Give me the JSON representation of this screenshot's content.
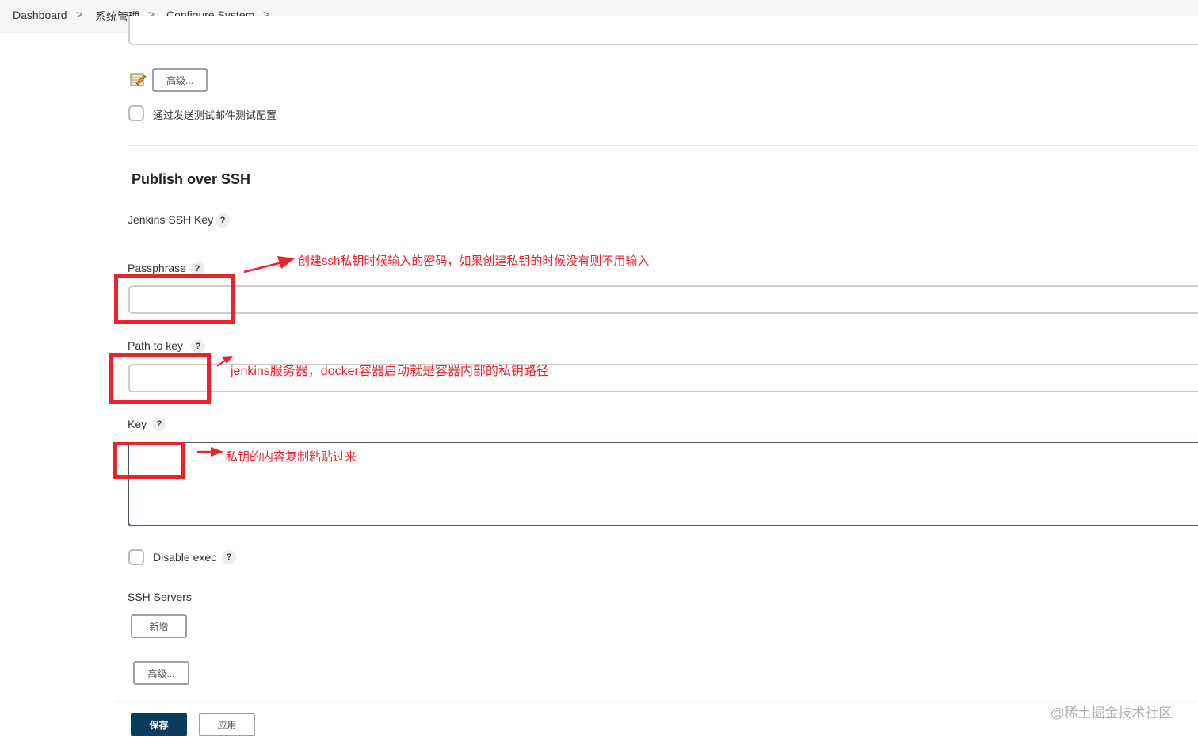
{
  "breadcrumb": {
    "items": [
      "Dashboard",
      "系统管理",
      "Configure System"
    ],
    "separator": ">"
  },
  "email": {
    "advanced_label": "高级...",
    "test_checkbox_label": "通过发送测试邮件测试配置"
  },
  "publish_ssh": {
    "title": "Publish over SSH",
    "jenkins_ssh_key_label": "Jenkins SSH Key",
    "passphrase_label": "Passphrase",
    "passphrase_value": "",
    "path_to_key_label": "Path to key",
    "path_to_key_value": "",
    "key_label": "Key",
    "key_value": "",
    "disable_exec_label": "Disable exec",
    "ssh_servers_label": "SSH Servers",
    "add_label": "新增",
    "advanced_label": "高级...",
    "help_glyph": "?"
  },
  "footer": {
    "save_label": "保存",
    "apply_label": "应用"
  },
  "annotations": {
    "passphrase_note": "创建ssh私钥时候输入的密码，如果创建私钥的时候没有则不用输入",
    "path_note": "jenkins服务器，docker容器启动就是容器内部的私钥路径",
    "key_note": "私钥的内容复制粘贴过来"
  },
  "watermark": "@稀土掘金技术社区",
  "colors": {
    "annotation_red": "#e8232c",
    "primary_button": "#0b3c5d",
    "breadcrumb_bg": "#f6f6f8"
  }
}
